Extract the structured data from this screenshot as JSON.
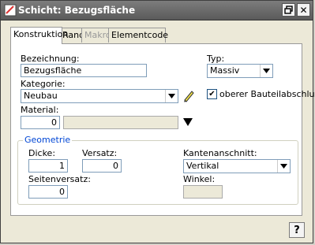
{
  "window": {
    "title": "Schicht: Bezugsfläche"
  },
  "tabs": [
    "Konstruktion",
    "Rand",
    "Makro",
    "Elementcode"
  ],
  "form": {
    "bezeichnung_label": "Bezeichnung:",
    "bezeichnung_value": "Bezugsfläche",
    "typ_label": "Typ:",
    "typ_value": "Massiv",
    "kategorie_label": "Kategorie:",
    "kategorie_value": "Neubau",
    "oberer_label": "oberer Bauteilabschluss",
    "oberer_checked": true,
    "material_label": "Material:",
    "material_value": "0"
  },
  "geometrie": {
    "title": "Geometrie",
    "dicke_label": "Dicke:",
    "dicke_value": "1",
    "versatz_label": "Versatz:",
    "versatz_value": "0",
    "seitenversatz_label": "Seitenversatz:",
    "seitenversatz_value": "0",
    "kantenanschnitt_label": "Kantenanschnitt:",
    "kantenanschnitt_value": "Vertikal",
    "winkel_label": "Winkel:"
  },
  "help_label": "?"
}
